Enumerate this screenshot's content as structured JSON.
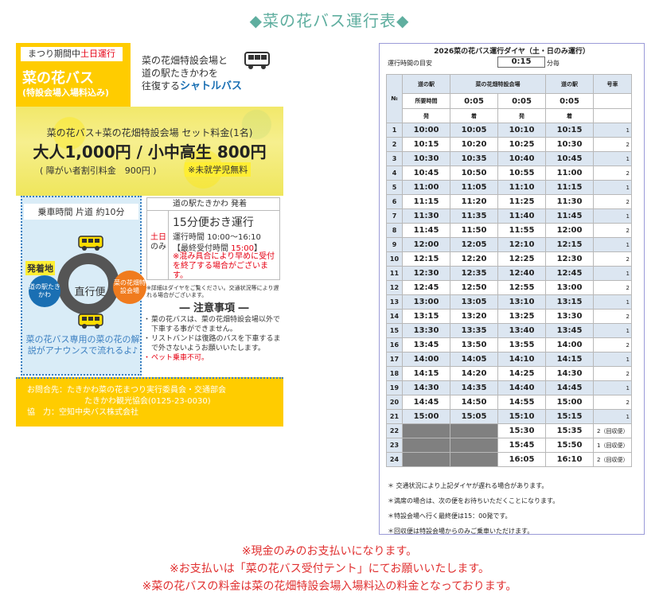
{
  "page_title": "◆菜の花バス運行表◆",
  "flyer": {
    "tag_prefix": "まつり期間中",
    "tag_red": "土日運行",
    "name": "菜の花バス",
    "sub": "(特設会場入場料込み)",
    "desc_line1": "菜の花畑特設会場と",
    "desc_line2": "道の駅たきかわを",
    "desc_line3_prefix": "往復する",
    "desc_line3_highlight": "シャトルバス",
    "set_label": "菜の花バス+菜の花畑特設会場 セット料金(1名)",
    "price": "大人1,000円 / 小中高生 800円",
    "discount": "( 障がい者割引料金　900円 )",
    "free": "※未就学児無料",
    "ride_time": "乗車時間 片道 約10分",
    "origin_label": "発着地",
    "origin_name": "道の駅たきかわ",
    "direct": "直行便",
    "dest_name": "菜の花畑特設会場",
    "announce": "菜の花バス専用の菜の花の解説がアナウンスで流れるよ♪",
    "sched_head": "道の駅たきかわ 発着",
    "sched_weekend_red": "土日",
    "sched_weekend": "のみ",
    "sched_every": "15分便おき運行",
    "sched_hours": "運行時間 10:00～16:10",
    "sched_last_prefix": "【最終受付時間",
    "sched_last_time": "15:00",
    "sched_last_suffix": "】",
    "sched_warn": "※混み具合により早めに受付を終了する場合がございます。",
    "sched_note": "※詳細はダイヤをご覧ください。交通状況等により遅れる場合がございます。",
    "caution_title": "― 注意事項 ―",
    "cautions": [
      "菜の花バスは、菜の花畑特設会場以外で下車する事ができません。",
      "リストバンドは復路のバスを下車するまで外さないようお願いいたします。"
    ],
    "caution_red": "ペット乗車不可。",
    "contact_1": "お問合先：たきかわ菜の花まつり実行委員会・交通部会",
    "contact_2": "たきかわ観光協会(0125-23-0030)",
    "contact_3": "協　力：空知中央バス株式会社"
  },
  "timetable": {
    "title": "2026菜の花バス運行ダイヤ（土・日のみ運行）",
    "interval_label": "運行時間の目安",
    "interval_value": "0:15",
    "interval_unit": "分毎",
    "headers": {
      "no": "№",
      "col1": "道の駅",
      "col2": "菜の花畑特設会場",
      "col3": "道の駅",
      "col4": "号車"
    },
    "travel_label": "所要時間",
    "travel": [
      "0:05",
      "0:05",
      "0:05"
    ],
    "dep": "発",
    "arr": "着",
    "rows": [
      {
        "no": "1",
        "a": "10:00",
        "b": "10:05",
        "c": "10:10",
        "d": "10:15",
        "bus": "1"
      },
      {
        "no": "2",
        "a": "10:15",
        "b": "10:20",
        "c": "10:25",
        "d": "10:30",
        "bus": "2"
      },
      {
        "no": "3",
        "a": "10:30",
        "b": "10:35",
        "c": "10:40",
        "d": "10:45",
        "bus": "1"
      },
      {
        "no": "4",
        "a": "10:45",
        "b": "10:50",
        "c": "10:55",
        "d": "11:00",
        "bus": "2"
      },
      {
        "no": "5",
        "a": "11:00",
        "b": "11:05",
        "c": "11:10",
        "d": "11:15",
        "bus": "1"
      },
      {
        "no": "6",
        "a": "11:15",
        "b": "11:20",
        "c": "11:25",
        "d": "11:30",
        "bus": "2"
      },
      {
        "no": "7",
        "a": "11:30",
        "b": "11:35",
        "c": "11:40",
        "d": "11:45",
        "bus": "1"
      },
      {
        "no": "8",
        "a": "11:45",
        "b": "11:50",
        "c": "11:55",
        "d": "12:00",
        "bus": "2"
      },
      {
        "no": "9",
        "a": "12:00",
        "b": "12:05",
        "c": "12:10",
        "d": "12:15",
        "bus": "1"
      },
      {
        "no": "10",
        "a": "12:15",
        "b": "12:20",
        "c": "12:25",
        "d": "12:30",
        "bus": "2"
      },
      {
        "no": "11",
        "a": "12:30",
        "b": "12:35",
        "c": "12:40",
        "d": "12:45",
        "bus": "1"
      },
      {
        "no": "12",
        "a": "12:45",
        "b": "12:50",
        "c": "12:55",
        "d": "13:00",
        "bus": "2"
      },
      {
        "no": "13",
        "a": "13:00",
        "b": "13:05",
        "c": "13:10",
        "d": "13:15",
        "bus": "1"
      },
      {
        "no": "14",
        "a": "13:15",
        "b": "13:20",
        "c": "13:25",
        "d": "13:30",
        "bus": "2"
      },
      {
        "no": "15",
        "a": "13:30",
        "b": "13:35",
        "c": "13:40",
        "d": "13:45",
        "bus": "1"
      },
      {
        "no": "16",
        "a": "13:45",
        "b": "13:50",
        "c": "13:55",
        "d": "14:00",
        "bus": "2"
      },
      {
        "no": "17",
        "a": "14:00",
        "b": "14:05",
        "c": "14:10",
        "d": "14:15",
        "bus": "1"
      },
      {
        "no": "18",
        "a": "14:15",
        "b": "14:20",
        "c": "14:25",
        "d": "14:30",
        "bus": "2"
      },
      {
        "no": "19",
        "a": "14:30",
        "b": "14:35",
        "c": "14:40",
        "d": "14:45",
        "bus": "1"
      },
      {
        "no": "20",
        "a": "14:45",
        "b": "14:50",
        "c": "14:55",
        "d": "15:00",
        "bus": "2"
      },
      {
        "no": "21",
        "a": "15:00",
        "b": "15:05",
        "c": "15:10",
        "d": "15:15",
        "bus": "1"
      }
    ],
    "return_rows": [
      {
        "no": "22",
        "c": "15:30",
        "d": "15:35",
        "bus": "2（回収便）"
      },
      {
        "no": "23",
        "c": "15:45",
        "d": "15:50",
        "bus": "1（回収便）"
      },
      {
        "no": "24",
        "c": "16:05",
        "d": "16:10",
        "bus": "2（回収便）"
      }
    ],
    "notes": [
      "＊ 交通状況により上記ダイヤが遅れる場合があります。",
      "＊満席の場合は、次の便をお待ちいただくことになります。",
      "＊特設会場へ行く最終便は15：00発です。",
      "＊回収便は特設会場からのみご乗車いただけます。"
    ]
  },
  "bottom_notes": [
    "※現金のみのお支払いになります。",
    "※お支払いは「菜の花バス受付テント」にてお願いいたします。",
    "※菜の花バスの料金は菜の花畑特設会場入場料込の料金となっております。"
  ]
}
